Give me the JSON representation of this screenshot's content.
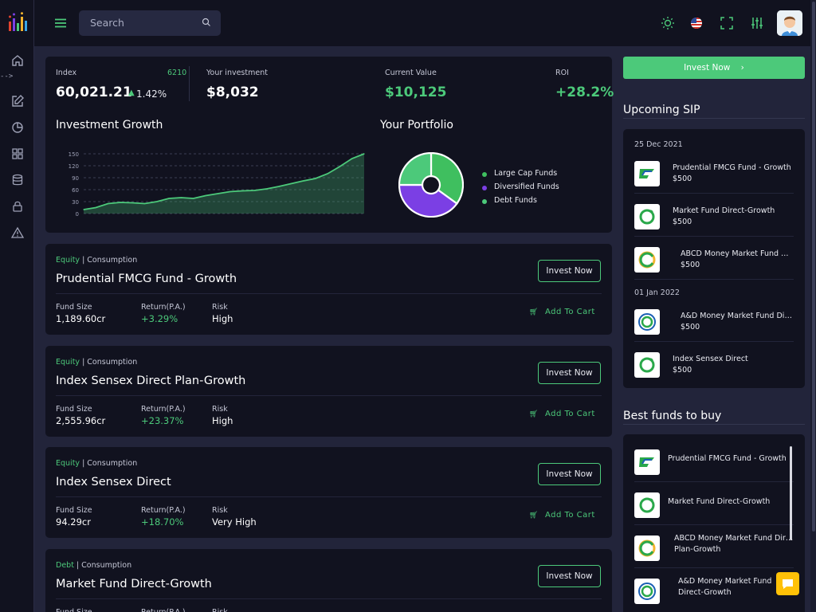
{
  "topbar": {
    "search_placeholder": "Search",
    "icons": [
      "sun-icon",
      "us-flag-icon",
      "fullscreen-icon",
      "sliders-icon"
    ]
  },
  "sidebar": {
    "icons": [
      "home-icon",
      "edit-icon",
      "pie-chart-icon",
      "grid-icon",
      "database-icon",
      "lock-icon",
      "alert-icon"
    ],
    "arrow_text": "-->"
  },
  "stats": {
    "index_label": "Index",
    "index_count": "6210",
    "index_value": "60,021.21",
    "index_change": "1.42%",
    "investment_label": "Your investment",
    "investment_value": "$8,032",
    "current_label": "Current Value",
    "current_value": "$10,125",
    "roi_label": "ROI",
    "roi_value": "+28.2%"
  },
  "growth": {
    "title": "Investment Growth"
  },
  "portfolio": {
    "title": "Your Portfolio",
    "legend": [
      "Large Cap Funds",
      "Diversified Funds",
      "Debt Funds"
    ]
  },
  "chart_data": [
    {
      "type": "area",
      "title": "Investment Growth",
      "ylim": [
        0,
        150
      ],
      "yticks": [
        0,
        30,
        60,
        90,
        120,
        150
      ],
      "grid": true,
      "values": [
        10,
        15,
        25,
        28,
        27,
        25,
        30,
        38,
        40,
        38,
        45,
        50,
        55,
        57,
        58,
        62,
        68,
        75,
        82,
        88,
        100,
        118,
        138,
        150
      ]
    },
    {
      "type": "pie",
      "title": "Your Portfolio",
      "legend_position": "right",
      "slices": [
        {
          "name": "Large Cap Funds",
          "value": 35,
          "color": "#3fbf5f"
        },
        {
          "name": "Diversified Funds",
          "value": 40,
          "color": "#7b3fe4"
        },
        {
          "name": "Debt Funds",
          "value": 25,
          "color": "#4cc97a"
        }
      ]
    }
  ],
  "funds": [
    {
      "type": "Equity",
      "category": "Consumption",
      "name": "Prudential FMCG Fund - Growth",
      "fund_size": "1,189.60cr",
      "return": "+3.29%",
      "risk": "High"
    },
    {
      "type": "Equity",
      "category": "Consumption",
      "name": "Index Sensex Direct Plan-Growth",
      "fund_size": "2,555.96cr",
      "return": "+23.37%",
      "risk": "High"
    },
    {
      "type": "Equity",
      "category": "Consumption",
      "name": "Index Sensex Direct",
      "fund_size": "94.29cr",
      "return": "+18.70%",
      "risk": "Very High"
    },
    {
      "type": "Debt",
      "category": "Consumption",
      "name": "Market Fund Direct-Growth",
      "fund_size": "",
      "return": "",
      "risk": ""
    }
  ],
  "fund_labels": {
    "fund_size": "Fund Size",
    "return": "Return(P.A.)",
    "risk": "Risk",
    "invest_now": "Invest Now",
    "add_to_cart": "Add To Cart",
    "separator": " | "
  },
  "right": {
    "invest_now": "Invest Now",
    "upcoming_title": "Upcoming SIP",
    "sip_groups": [
      {
        "date": "25 Dec 2021",
        "items": [
          {
            "name": "Prudential FMCG Fund - Growth",
            "amount": "$500"
          },
          {
            "name": "Market Fund Direct-Growth",
            "amount": "$500"
          },
          {
            "name": "ABCD Money Market Fund Direct Plan-Growth",
            "amount": "$500"
          }
        ]
      },
      {
        "date": "01 Jan 2022",
        "items": [
          {
            "name": "A&D Money Market Fund Direct-Growth",
            "amount": "$500"
          },
          {
            "name": "Index Sensex Direct",
            "amount": "$500"
          }
        ]
      }
    ],
    "best_title": "Best funds to buy",
    "best": [
      {
        "line1": "Prudential FMCG Fund - Growth",
        "line2": ""
      },
      {
        "line1": "Market Fund Direct-Growth",
        "line2": ""
      },
      {
        "line1": "ABCD Money Market Fund Direct",
        "line2": "Plan-Growth"
      },
      {
        "line1": "A&D Money Market Fund",
        "line2": "Direct-Growth"
      }
    ]
  },
  "colors": {
    "accent": "#4cc97a",
    "panel": "#11121f",
    "background": "#22243a",
    "purple": "#7b3fe4"
  }
}
